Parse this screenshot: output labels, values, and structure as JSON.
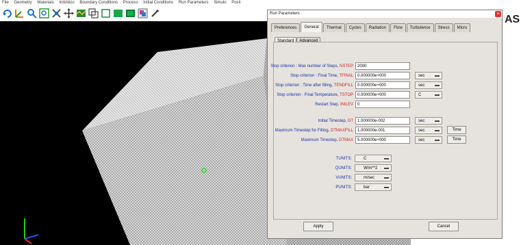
{
  "menubar": [
    "File",
    "Geometry",
    "Materials",
    "InitiAlizo",
    "Boundary Conditions",
    "Process",
    "Initial Conditions",
    "Run Parameters",
    "Simulo",
    "Posti"
  ],
  "right_text": "AS",
  "dialog": {
    "title": "Run Parameters",
    "close": "×",
    "tabs": [
      "Preferences",
      "General",
      "Thermal",
      "Cycles",
      "Radiation",
      "Flow",
      "Turbulence",
      "Stress",
      "Micro"
    ],
    "active_tab": "General",
    "subtabs": [
      "Standard",
      "Advanced"
    ],
    "fields": [
      {
        "label": "Stop criterion : Max number of Steps,",
        "var": "NSTEP",
        "value": "2000",
        "unit": "",
        "time": ""
      },
      {
        "label": "Stop criterion : Final Time,",
        "var": "TFINAL",
        "value": "0.000000e+000",
        "unit": "sec",
        "time": ""
      },
      {
        "label": "Stop criterion : Time after filling,",
        "var": "TENDFILL",
        "value": "0.000000e+000",
        "unit": "sec",
        "time": ""
      },
      {
        "label": "Stop criterion : Final Temperature,",
        "var": "TSTOP",
        "value": "0.000000e+000",
        "unit": "C",
        "time": ""
      },
      {
        "label": "Restart Step,",
        "var": "INILEV",
        "value": "0",
        "unit": "",
        "time": ""
      },
      {
        "label": "Initial Timestep,",
        "var": "DT",
        "value": "1.000000e-002",
        "unit": "sec",
        "time": ""
      },
      {
        "label": "Maximum Timestep for Filling,",
        "var": "DTMAXFILL",
        "value": "1.000000e-001",
        "unit": "sec",
        "time": "Time"
      },
      {
        "label": "Maximum Timestep,",
        "var": "DTMAX",
        "value": "5.000000e+000",
        "unit": "sec",
        "time": "Time"
      }
    ],
    "units": [
      {
        "label": "TUNITS:",
        "value": "C"
      },
      {
        "label": "QUNITS:",
        "value": "W/m**2"
      },
      {
        "label": "VUNITS:",
        "value": "m/sec"
      },
      {
        "label": "PUNITS:",
        "value": "bar"
      }
    ],
    "apply_label": "Apply",
    "cancel_label": "Cancel"
  }
}
